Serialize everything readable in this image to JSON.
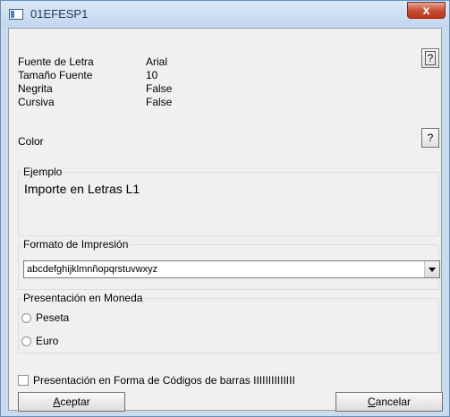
{
  "window": {
    "title": "01EFESP1",
    "close_label": "x"
  },
  "font_info": {
    "rows": [
      {
        "label": "Fuente de Letra",
        "value": "Arial"
      },
      {
        "label": "Tamaño Fuente",
        "value": "10"
      },
      {
        "label": "Negrita",
        "value": "False"
      },
      {
        "label": "Cursiva",
        "value": "False"
      }
    ],
    "font_button_label": "?"
  },
  "color": {
    "label": "Color",
    "button_label": "?"
  },
  "example": {
    "legend": "Ejemplo",
    "text": "Importe en Letras L1"
  },
  "print_format": {
    "legend": "Formato de Impresión",
    "selected": "abcdefghijklmnñopqrstuvwxyz"
  },
  "currency": {
    "legend": "Presentación en Moneda",
    "options": [
      {
        "label": "Peseta",
        "checked": false
      },
      {
        "label": "Euro",
        "checked": false
      }
    ]
  },
  "barcode": {
    "label": "Presentación en Forma de Códigos de barras IIIIIIIIIIIIII",
    "checked": false
  },
  "buttons": {
    "accept": {
      "accel": "A",
      "rest": "ceptar"
    },
    "cancel": {
      "accel": "C",
      "rest": "ancelar"
    }
  }
}
